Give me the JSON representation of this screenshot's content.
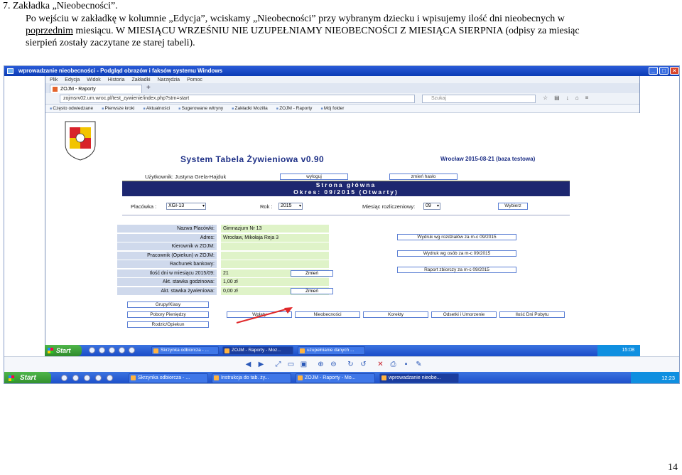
{
  "document": {
    "heading": "7. Zakładka „Nieobecności”.",
    "para_line1": "Po wejściu w zakładkę w kolumnie „Edycja”, wciskamy „Nieobecności” przy wybranym dziecku i wpisujemy ilość dni nieobecnych w",
    "para_line2_u": "poprzednim",
    "para_line2_rest": " miesiącu. W MIESIĄCU WRZEŚNIU NIE UZUPEŁNIAMY NIEOBECNOŚCI Z MIESIĄCA SIERPNIA (odpisy za miesiąc",
    "para_line3": "sierpień zostały zaczytane ze starej tabeli).",
    "page_number": "14"
  },
  "remote_window": {
    "title": "wprowadzanie nieobecności - Podgląd obrazów i faksów systemu Windows",
    "controls": [
      "_",
      "□",
      "×"
    ]
  },
  "browser": {
    "menu": [
      "Plik",
      "Edycja",
      "Widok",
      "Historia",
      "Zakładki",
      "Narzędzia",
      "Pomoc"
    ],
    "tab_title": "ZOJM - Raporty",
    "new_tab": "+",
    "url": "zojmsrv02.um.wroc.pl/test_zywienie/index.php?strn=start",
    "search_placeholder": "Szukaj",
    "bookmarks": [
      "Często odwiedzane",
      "Pierwsze kroki",
      "Aktualności",
      "Sugerowane witryny",
      "Zakładki Mozilla",
      "ZOJM - Raporty",
      "Mój folder"
    ]
  },
  "app": {
    "title": "System Tabela Żywieniowa v0.90",
    "city_date": "Wrocław 2015-08-21 (baza testowa)",
    "user_label": "Użytkownik: Justyna Grela-Hajduk",
    "logout_btn": "wyloguj",
    "change_password_btn": "zmień hasło",
    "header_line1": "Strona główna",
    "header_line2": "Okres: 09/2015 (Otwarty)",
    "filters": {
      "placowka_label": "Placówka :",
      "placowka_value": "XGI-13",
      "rok_label": "Rok :",
      "rok_value": "2015",
      "miesiac_label": "Miesiąc rozliczeniowy:",
      "miesiac_value": "09",
      "choose_btn": "Wybierz"
    },
    "info_rows": [
      {
        "key": "Nazwa Placówki:",
        "value": "Gimnazjum Nr 13",
        "btn": ""
      },
      {
        "key": "Adres:",
        "value": "Wrocław, Mikołaja Reja 3",
        "btn": ""
      },
      {
        "key": "Kierownik w ZOJM:",
        "value": "",
        "btn": ""
      },
      {
        "key": "Pracownik (Opiekun) w ZOJM:",
        "value": "",
        "btn": ""
      },
      {
        "key": "Rachunek bankowy:",
        "value": "",
        "btn": ""
      },
      {
        "key": "Ilość dni w miesiącu 2015/09:",
        "value": "21",
        "btn": "Zmień"
      },
      {
        "key": "Akt. stawka godzinowa:",
        "value": "1,00 zł",
        "btn": ""
      },
      {
        "key": "Akt. stawka żywieniowa:",
        "value": "0,00 zł",
        "btn": "Zmień"
      }
    ],
    "reports": [
      "Wydruk wg rozdziałów za m-c 09/2015",
      "Wydruk wg osób za m-c 09/2015",
      "Raport zbiorczy za m-c 09/2015"
    ],
    "left_buttons": [
      "Grupy/Klasy",
      "Pobory Pieniędzy",
      "Rodzic/Opiekun"
    ],
    "bottom_buttons": [
      "Wpłaty",
      "Nieobecności",
      "Korekty",
      "Odsetki i Umorzenie",
      "Ilość Dni Pobytu"
    ]
  },
  "taskbar_inner": {
    "start": "Start",
    "tasks": [
      "Skrzynka odbiorcza - ...",
      "ZOJM - Raporty - Moz...",
      "uzupełnianie danych ..."
    ],
    "clock": "15:08"
  },
  "taskbar_outer": {
    "start": "Start",
    "tasks": [
      "Skrzynka odbiorcza - ...",
      "Instrukcja do tab. ży...",
      "ZOJM - Raporty - Mo...",
      "wprowadzanie nieobe..."
    ],
    "clock": "12:23"
  },
  "colors": {
    "header_bar": "#1d2770",
    "app_title": "#1d2f86",
    "label_cell": "#cfd9ec",
    "value_cell": "#dff3c8",
    "xp_taskbar": "#1a4cc8",
    "annotation_arrow": "#e0282a"
  }
}
